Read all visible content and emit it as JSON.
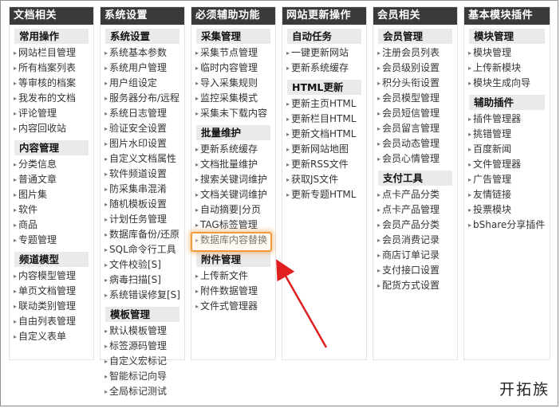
{
  "columns": [
    {
      "header": "文档相关",
      "sections": [
        {
          "title": "常用操作",
          "items": [
            "网站栏目管理",
            "所有档案列表",
            "等审核的档案",
            "我发布的文档",
            "评论管理",
            "内容回收站"
          ]
        },
        {
          "title": "内容管理",
          "items": [
            "分类信息",
            "普通文章",
            "图片集",
            "软件",
            "商品",
            "专题管理"
          ]
        },
        {
          "title": "频道模型",
          "items": [
            "内容模型管理",
            "单页文档管理",
            "联动类别管理",
            "自由列表管理",
            "自定义表单"
          ]
        }
      ]
    },
    {
      "header": "系统设置",
      "sections": [
        {
          "title": "系统设置",
          "items": [
            "系统基本参数",
            "系统用户管理",
            "用户组设定",
            "服务器分布/远程",
            "系统日志管理",
            "验证安全设置",
            "图片水印设置",
            "自定义文档属性",
            "软件频道设置",
            "防采集串混淆",
            "随机模板设置",
            "计划任务管理",
            "数据库备份/还原",
            "SQL命令行工具",
            "文件校验[S]",
            "病毒扫描[S]",
            "系统错误修复[S]"
          ]
        },
        {
          "title": "模板管理",
          "items": [
            "默认模板管理",
            "标签源码管理",
            "自定义宏标记",
            "智能标记向导",
            "全局标记测试"
          ]
        }
      ]
    },
    {
      "header": "必须辅助功能",
      "sections": [
        {
          "title": "采集管理",
          "items": [
            "采集节点管理",
            "临时内容管理",
            "导入采集规则",
            "监控采集模式",
            "采集未下载内容"
          ]
        },
        {
          "title": "批量维护",
          "items": [
            "更新系统缓存",
            "文档批量维护",
            "搜索关键词维护",
            "文档关键词维护",
            "自动摘要|分页",
            "TAG标签管理",
            "数据库内容替换"
          ]
        },
        {
          "title": "附件管理",
          "items": [
            "上传新文件",
            "附件数据管理",
            "文件式管理器"
          ]
        }
      ]
    },
    {
      "header": "网站更新操作",
      "sections": [
        {
          "title": "自动任务",
          "items": [
            "一键更新网站",
            "更新系统缓存"
          ]
        },
        {
          "title": "HTML更新",
          "items": [
            "更新主页HTML",
            "更新栏目HTML",
            "更新文档HTML",
            "更新网站地图",
            "更新RSS文件",
            "获取JS文件",
            "更新专题HTML"
          ]
        }
      ]
    },
    {
      "header": "会员相关",
      "sections": [
        {
          "title": "会员管理",
          "items": [
            "注册会员列表",
            "会员级别设置",
            "积分头衔设置",
            "会员模型管理",
            "会员短信管理",
            "会员留言管理",
            "会员动态管理",
            "会员心情管理"
          ]
        },
        {
          "title": "支付工具",
          "items": [
            "点卡产品分类",
            "点卡产品管理",
            "会员产品分类",
            "会员消费记录",
            "商店订单记录",
            "支付接口设置",
            "配货方式设置"
          ]
        }
      ]
    },
    {
      "header": "基本模块插件",
      "sections": [
        {
          "title": "模块管理",
          "items": [
            "模块管理",
            "上传新模块",
            "模块生成向导"
          ]
        },
        {
          "title": "辅助插件",
          "items": [
            "插件管理器",
            "挑错管理",
            "百度新闻",
            "文件管理器",
            "广告管理",
            "友情链接",
            "投票模块",
            "bShare分享插件"
          ]
        }
      ]
    }
  ],
  "highlighted_item": "数据库内容替换",
  "watermark": "开拓族",
  "colors": {
    "header_bg": "#3a3a3a",
    "section_bg": "#eaeaea",
    "highlight": "#f39a3e",
    "arrow": "#e02020"
  }
}
